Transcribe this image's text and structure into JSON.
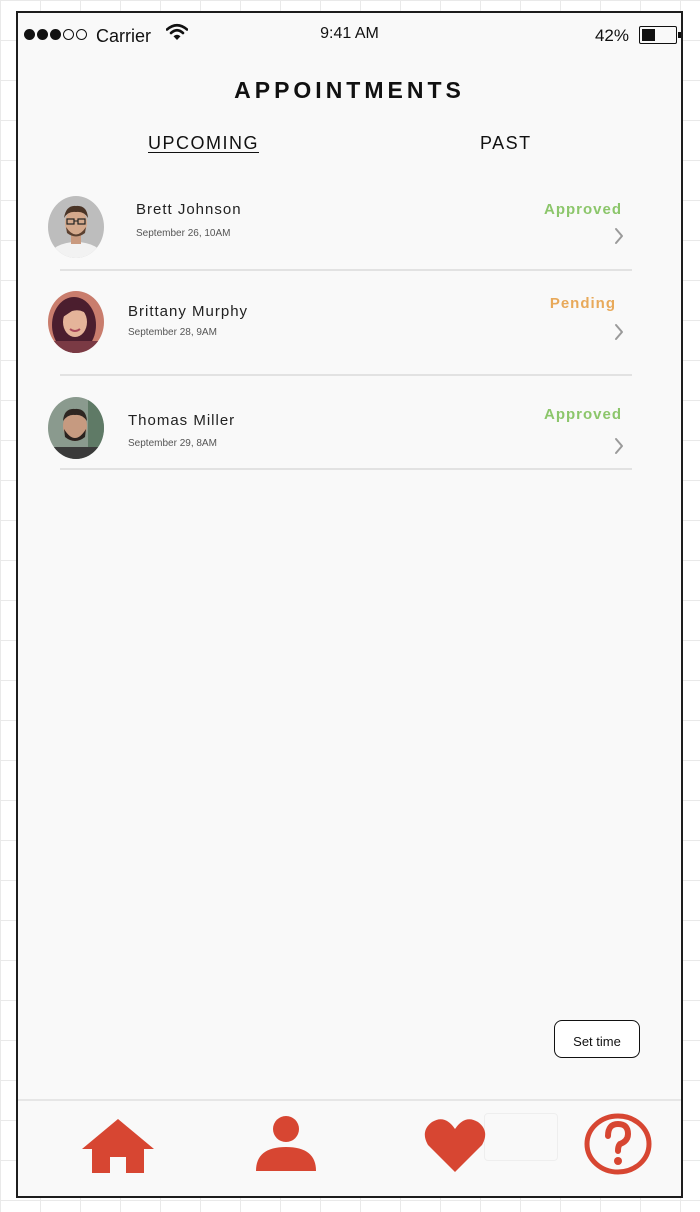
{
  "colors": {
    "accent": "#d74632",
    "approved": "#8cc66b",
    "pending": "#e8a95a"
  },
  "status_bar": {
    "carrier": "Carrier",
    "time": "9:41 AM",
    "battery": "42%",
    "signal_bars": 3,
    "signal_total": 5,
    "battery_level": 0.42
  },
  "page_title": "APPOINTMENTS",
  "tabs": {
    "upcoming": "UPCOMING",
    "past": "PAST",
    "active": "upcoming"
  },
  "appointments": [
    {
      "name": "Brett Johnson",
      "datetime": "September 26, 10AM",
      "status": "Approved"
    },
    {
      "name": "Brittany Murphy",
      "datetime": "September 28, 9AM",
      "status": "Pending"
    },
    {
      "name": "Thomas Miller",
      "datetime": "September 29, 8AM",
      "status": "Approved"
    }
  ],
  "set_time_label": "Set time",
  "nav": {
    "items": [
      "home-icon",
      "person-icon",
      "heart-icon",
      "help-icon"
    ]
  }
}
